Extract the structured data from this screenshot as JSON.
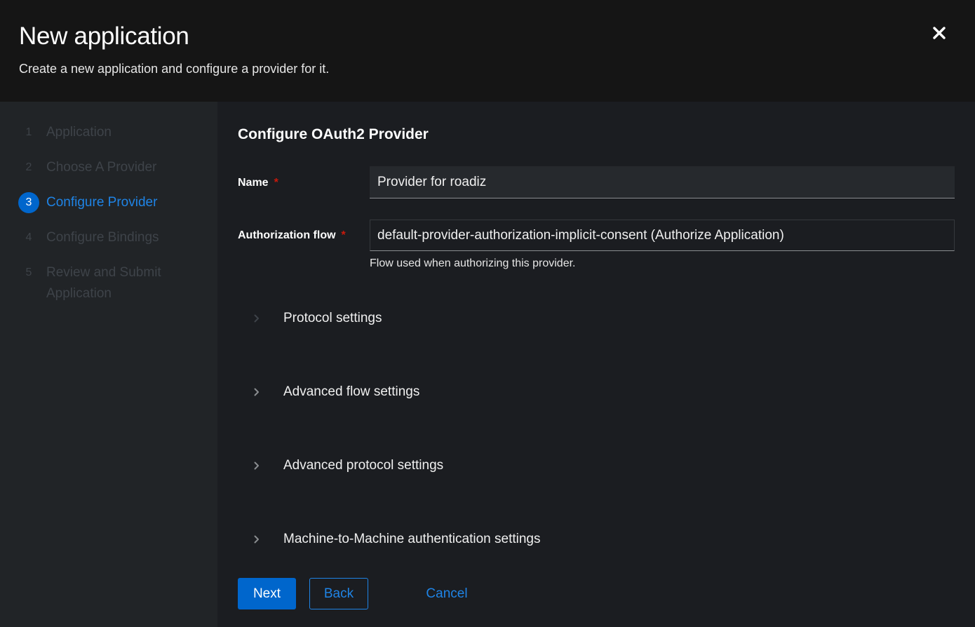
{
  "header": {
    "title": "New application",
    "description": "Create a new application and configure a provider for it."
  },
  "steps": [
    {
      "number": "1",
      "label": "Application",
      "state": "completed"
    },
    {
      "number": "2",
      "label": "Choose A Provider",
      "state": "completed"
    },
    {
      "number": "3",
      "label": "Configure Provider",
      "state": "current"
    },
    {
      "number": "4",
      "label": "Configure Bindings",
      "state": "pending"
    },
    {
      "number": "5",
      "label": "Review and Submit Application",
      "state": "pending"
    }
  ],
  "form": {
    "title": "Configure OAuth2 Provider",
    "name_label": "Name",
    "name_value": "Provider for roadiz",
    "required_mark": "*",
    "auth_flow_label": "Authorization flow",
    "auth_flow_value": "default-provider-authorization-implicit-consent (Authorize Application)",
    "auth_flow_help": "Flow used when authorizing this provider."
  },
  "sections": [
    {
      "label": "Protocol settings"
    },
    {
      "label": "Advanced flow settings"
    },
    {
      "label": "Advanced protocol settings"
    },
    {
      "label": "Machine-to-Machine authentication settings"
    }
  ],
  "footer": {
    "next_label": "Next",
    "back_label": "Back",
    "cancel_label": "Cancel"
  },
  "colors": {
    "primary": "#0066cc",
    "link": "#1f84e6",
    "required": "#c9190b"
  }
}
